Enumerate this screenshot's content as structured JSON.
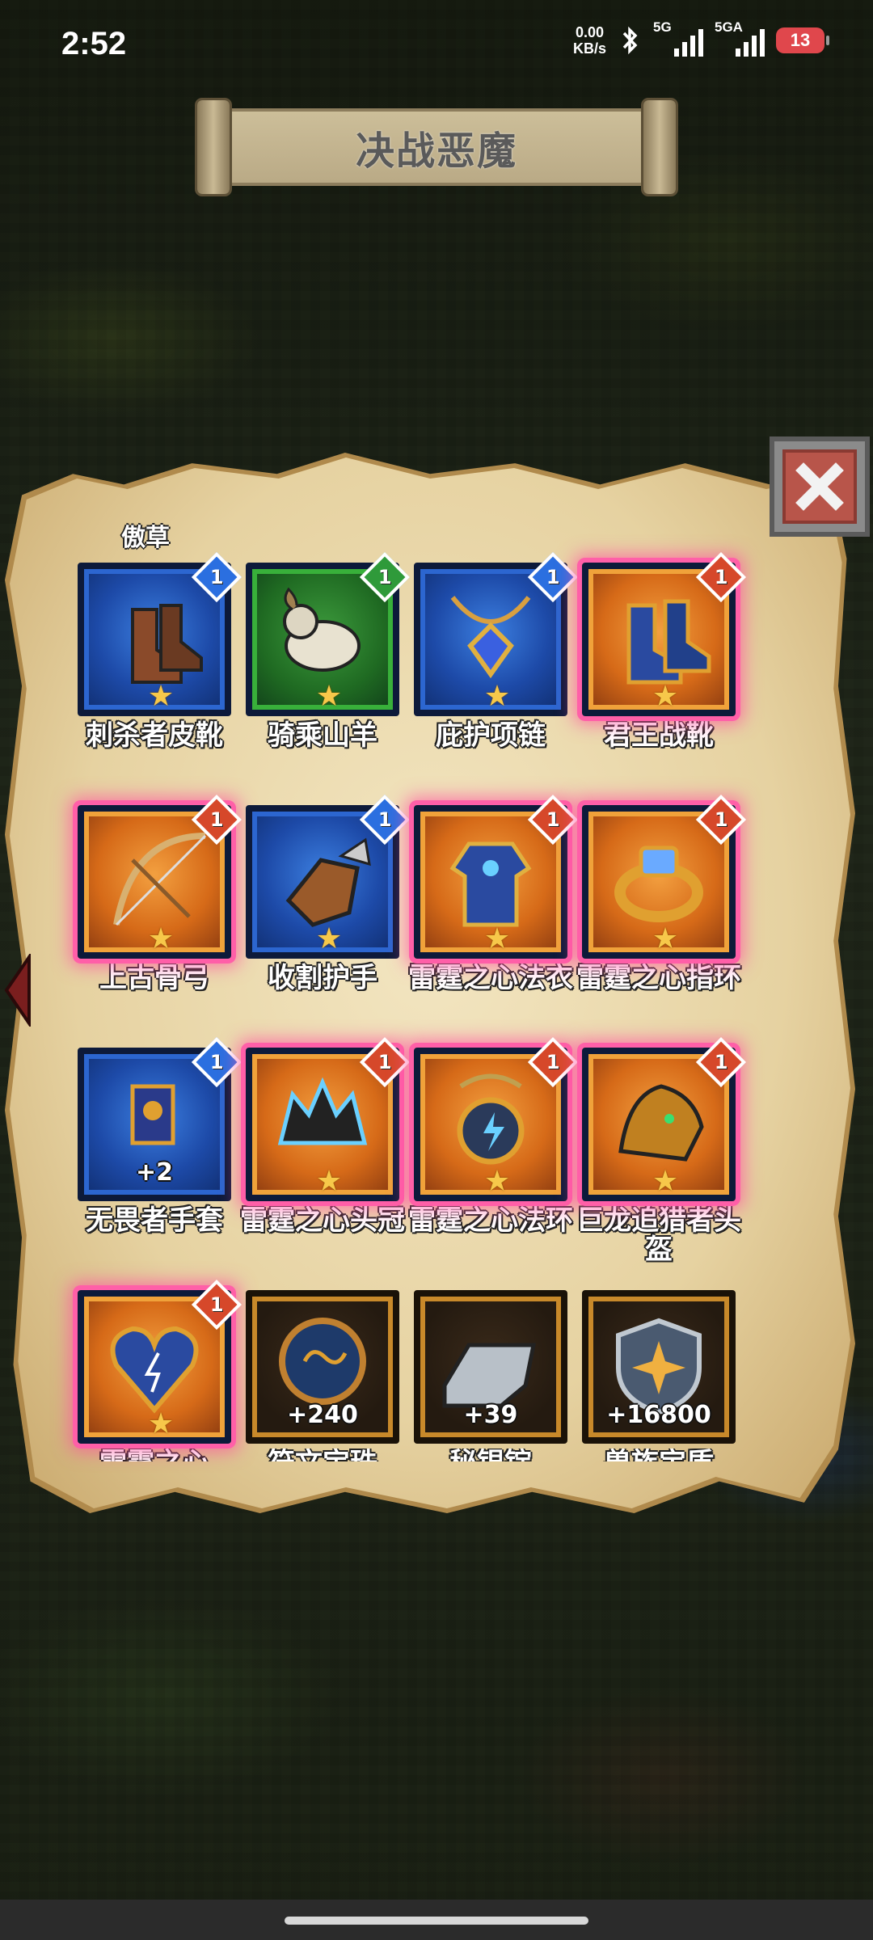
{
  "status_bar": {
    "time": "2:52",
    "net_speed_value": "0.00",
    "net_speed_unit": "KB/s",
    "signal1_label": "5G",
    "signal2_label": "5GA",
    "battery": "13"
  },
  "title": "决战恶魔",
  "section_label": "傲草",
  "items": [
    {
      "name": "刺杀者皮靴",
      "rarity": "blue",
      "level": "1",
      "icon": "boots-icon"
    },
    {
      "name": "骑乘山羊",
      "rarity": "green",
      "level": "1",
      "icon": "goat-mount-icon"
    },
    {
      "name": "庇护项链",
      "rarity": "blue",
      "level": "1",
      "icon": "necklace-icon"
    },
    {
      "name": "君王战靴",
      "rarity": "orange",
      "level": "1",
      "icon": "war-boots-icon"
    },
    {
      "name": "上古骨弓",
      "rarity": "orange",
      "level": "1",
      "icon": "bow-icon"
    },
    {
      "name": "收割护手",
      "rarity": "blue",
      "level": "1",
      "icon": "gauntlet-icon"
    },
    {
      "name": "雷霆之心法衣",
      "rarity": "orange",
      "level": "1",
      "icon": "robe-icon"
    },
    {
      "name": "雷霆之心指环",
      "rarity": "orange",
      "level": "1",
      "icon": "ring-icon"
    },
    {
      "name": "无畏者手套",
      "rarity": "blue",
      "level": "1",
      "icon": "glove-icon",
      "count": "+2"
    },
    {
      "name": "雷霆之心头冠",
      "rarity": "orange",
      "level": "1",
      "icon": "crown-icon"
    },
    {
      "name": "雷霆之心法环",
      "rarity": "orange",
      "level": "1",
      "icon": "amulet-icon"
    },
    {
      "name": "巨龙追猎者头盔",
      "rarity": "orange",
      "level": "1",
      "icon": "dragon-helm-icon"
    },
    {
      "name": "雷霆之心",
      "rarity": "orange",
      "level": "1",
      "icon": "heart-icon",
      "cut": true
    },
    {
      "name": "符文宝珠",
      "rarity": "dark",
      "icon": "orb-icon",
      "count": "+240",
      "cut": true
    },
    {
      "name": "秘银锭",
      "rarity": "dark",
      "icon": "ingot-icon",
      "count": "+39",
      "cut": true
    },
    {
      "name": "兽族宝盾",
      "rarity": "dark",
      "icon": "shield-icon",
      "count": "+16800",
      "cut": true
    }
  ]
}
